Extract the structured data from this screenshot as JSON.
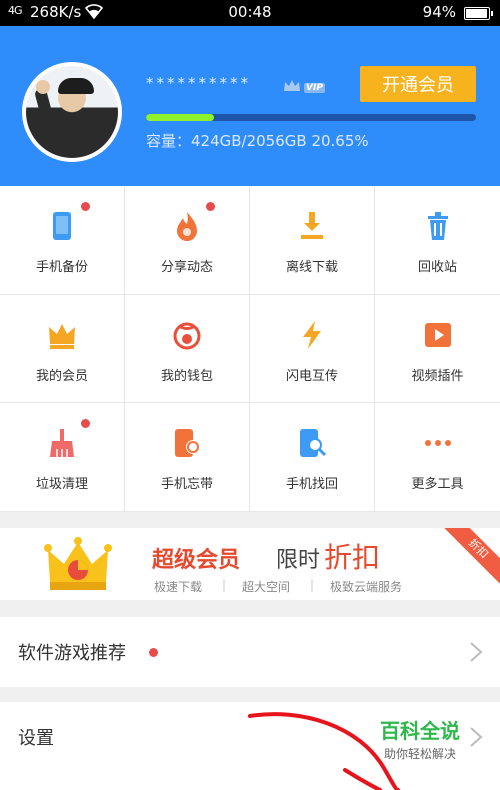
{
  "status_bar": {
    "signal": "4G",
    "net_speed": "268K/s",
    "time": "00:48",
    "battery": "94%",
    "battery_level": 0.94
  },
  "profile": {
    "username": "**********",
    "vip_badge": "VIP",
    "open_vip_button": "开通会员",
    "storage_used_fraction": 0.2065,
    "capacity_text": "容量：424GB/2056GB 20.65%"
  },
  "grid": [
    {
      "label": "手机备份",
      "icon": "phone-backup-icon",
      "color": "#3d9bf4",
      "badge": true
    },
    {
      "label": "分享动态",
      "icon": "flame-icon",
      "color": "#f2733a",
      "badge": true
    },
    {
      "label": "离线下载",
      "icon": "download-icon",
      "color": "#f5a623",
      "badge": false
    },
    {
      "label": "回收站",
      "icon": "trash-icon",
      "color": "#3d9bf4",
      "badge": false
    },
    {
      "label": "我的会员",
      "icon": "crown-icon",
      "color": "#f5a623",
      "badge": false
    },
    {
      "label": "我的钱包",
      "icon": "wallet-icon",
      "color": "#e8503a",
      "badge": false
    },
    {
      "label": "闪电互传",
      "icon": "lightning-icon",
      "color": "#f5a623",
      "badge": false
    },
    {
      "label": "视频插件",
      "icon": "video-play-icon",
      "color": "#f2733a",
      "badge": false
    },
    {
      "label": "垃圾清理",
      "icon": "broom-icon",
      "color": "#f06a6a",
      "badge": true
    },
    {
      "label": "手机忘带",
      "icon": "phone-remote-icon",
      "color": "#f2733a",
      "badge": false
    },
    {
      "label": "手机找回",
      "icon": "phone-search-icon",
      "color": "#3d9bf4",
      "badge": false
    },
    {
      "label": "更多工具",
      "icon": "more-dots-icon",
      "color": "#f2733a",
      "badge": false
    }
  ],
  "banner": {
    "title_main": "超级会员",
    "title_sub": "限时",
    "title_highlight": "折扣",
    "features": [
      "极速下载",
      "超大空间",
      "极致云端服务"
    ],
    "ribbon": "折扣"
  },
  "list": [
    {
      "label": "软件游戏推荐",
      "badge": true
    },
    {
      "label": "设置",
      "badge": false
    }
  ],
  "watermark": {
    "line1": "百科全说",
    "line2": "助你轻松解决"
  }
}
